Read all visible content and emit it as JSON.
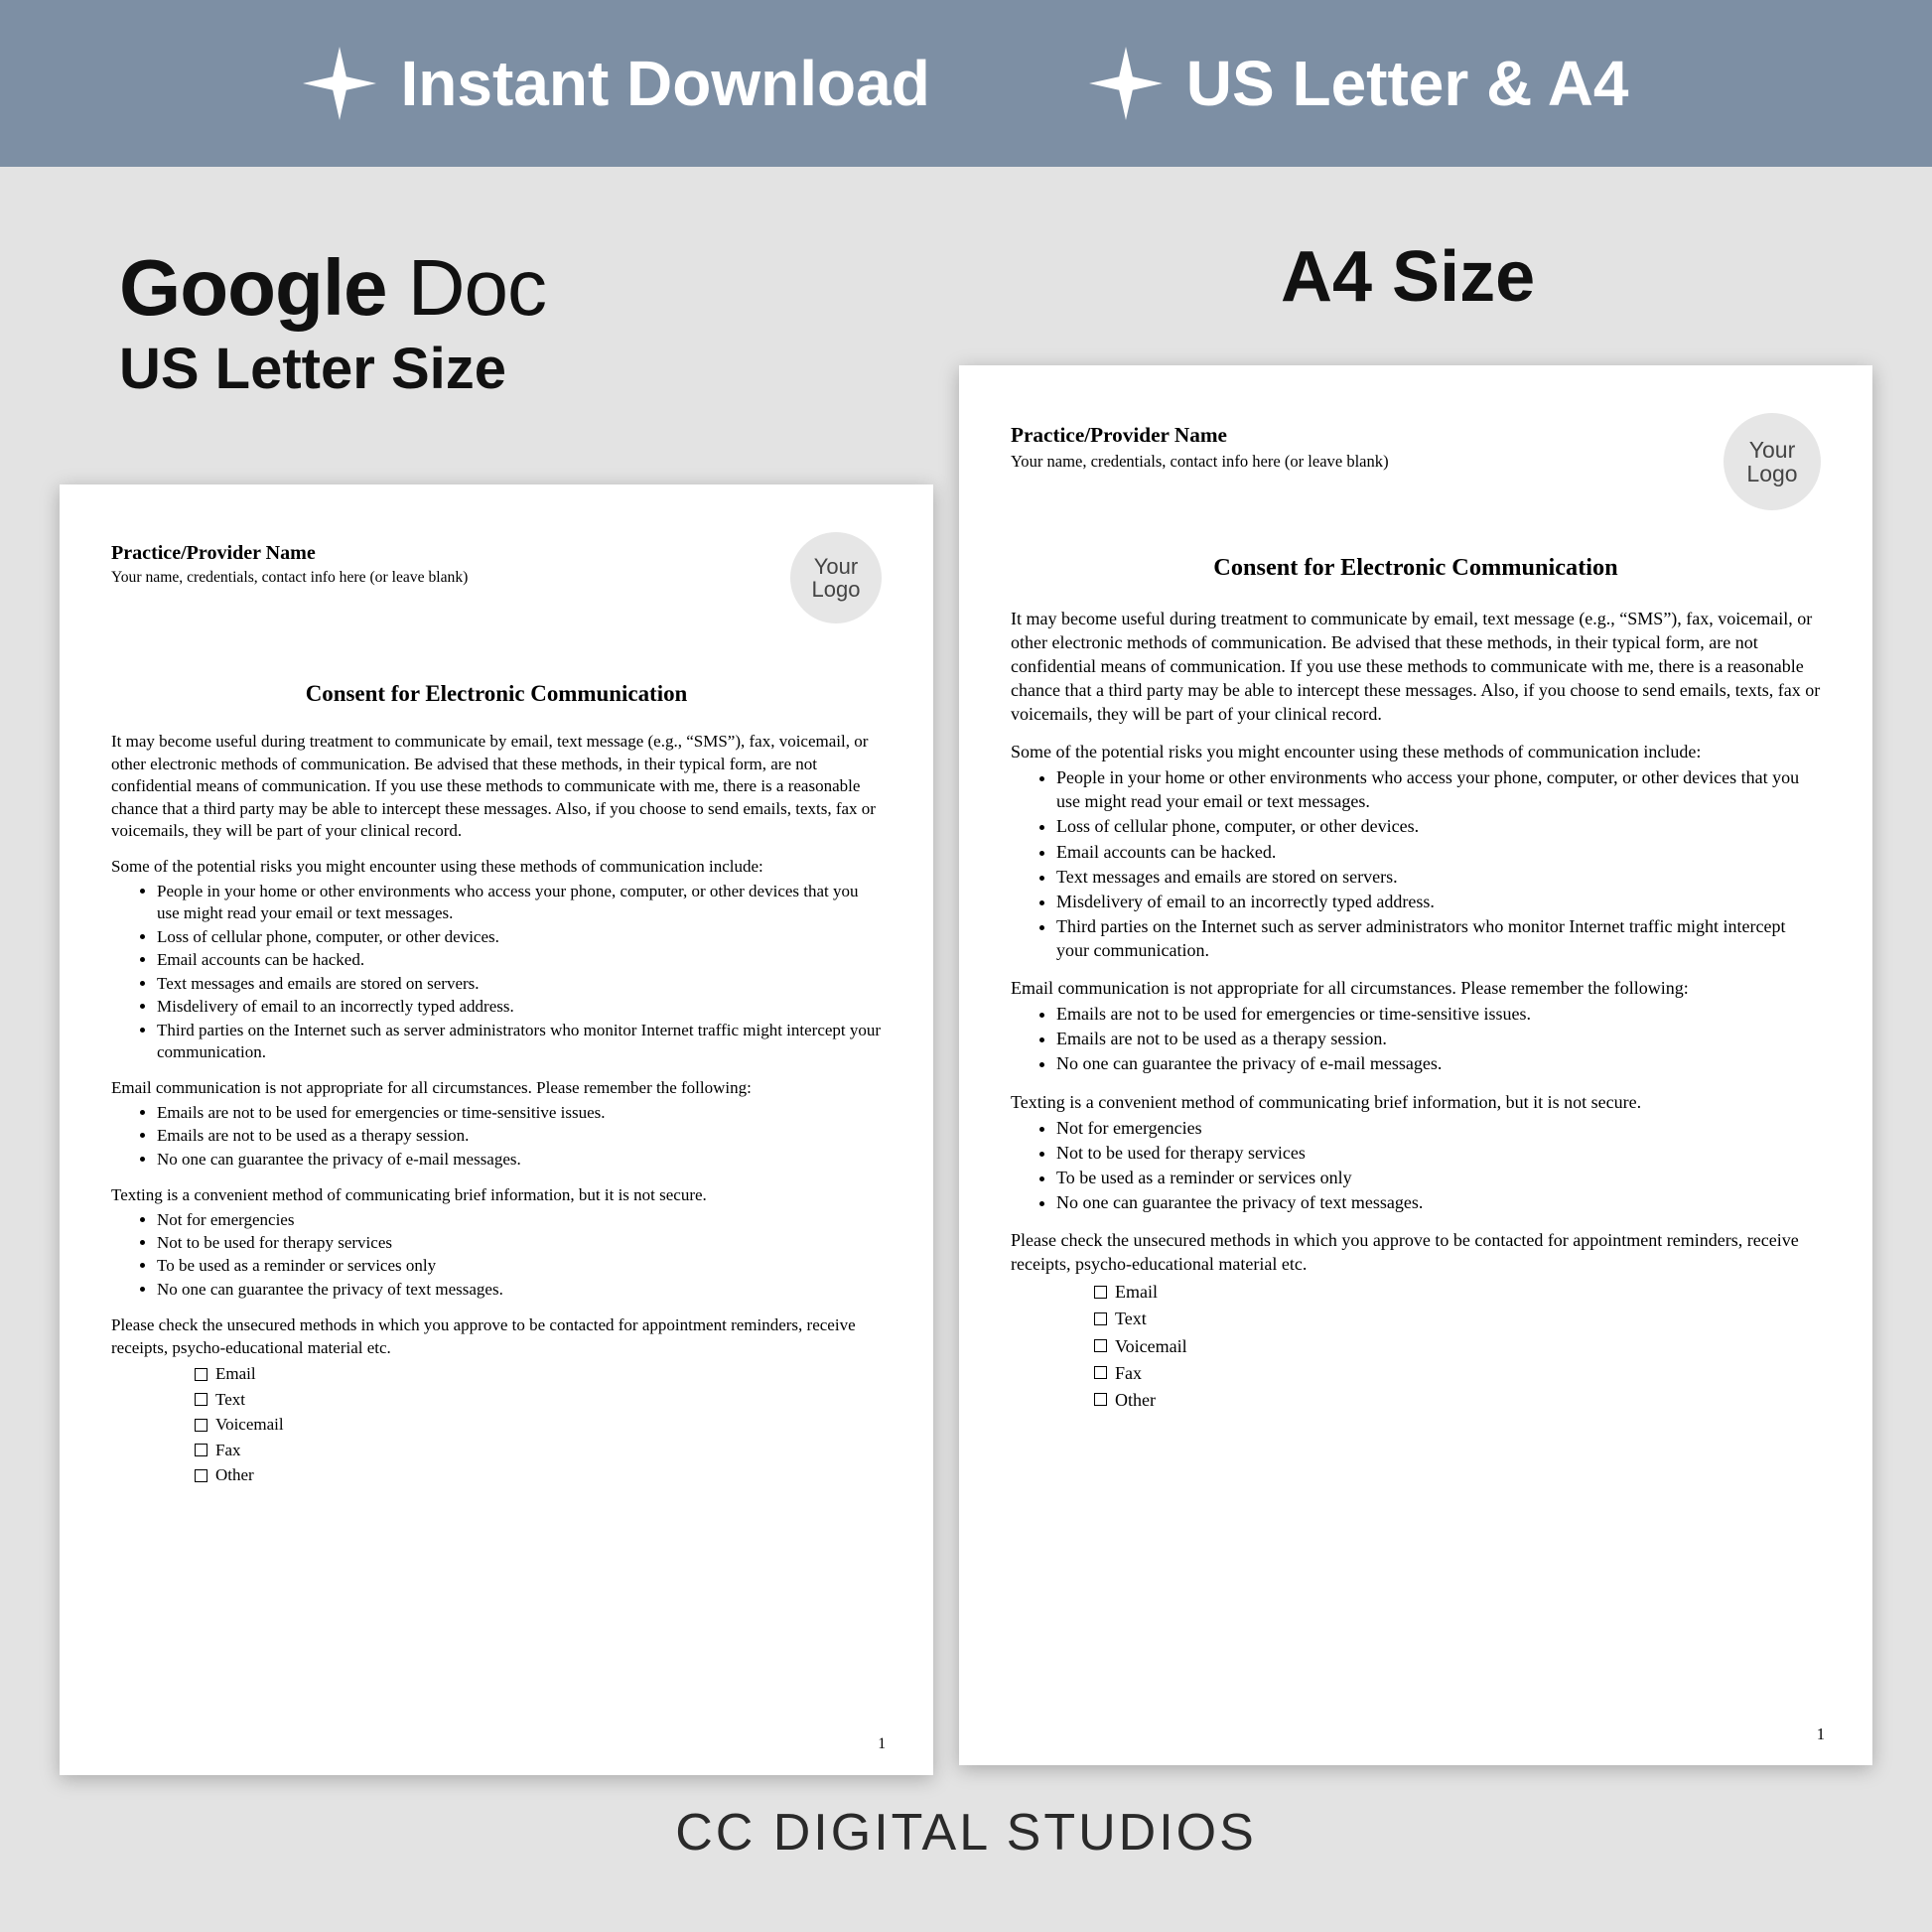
{
  "banner": {
    "item1": "Instant Download",
    "item2": "US Letter & A4"
  },
  "headings": {
    "google_bold": "Google",
    "google_light": " Doc",
    "us_letter": "US Letter Size",
    "a4": "A4 Size"
  },
  "doc": {
    "practice_name": "Practice/Provider Name",
    "practice_sub": "Your name, credentials, contact info here (or leave blank)",
    "logo_text": "Your Logo",
    "title": "Consent for Electronic Communication",
    "intro": "It may become useful during treatment to communicate by email, text message (e.g., “SMS”), fax, voicemail, or other electronic methods of communication. Be advised that these methods, in their typical form, are not confidential means of communication. If you use these methods to communicate with me, there is a reasonable chance that a third party may be able to intercept these messages.  Also, if you choose to send emails, texts, fax or voicemails, they will be part of your clinical record.",
    "risks_lead": "Some of the potential risks you might encounter using these methods of communication include:",
    "risks": [
      "People in your home or other environments who access your phone, computer, or other devices that you use might read your email or text messages.",
      "Loss of cellular phone, computer, or other devices.",
      "Email accounts can be hacked.",
      "Text messages and emails are stored on servers.",
      "Misdelivery of email to an incorrectly typed address.",
      "Third parties on the Internet such as server administrators who monitor Internet traffic might intercept your communication."
    ],
    "email_lead": "Email communication is not appropriate for all circumstances.  Please remember the following:",
    "email_notes": [
      "Emails are not to be used for emergencies or time-sensitive issues.",
      "Emails are not to be used as a therapy session.",
      "No one can guarantee the privacy of e-mail messages."
    ],
    "text_lead": "Texting is a convenient method of communicating brief information, but it is not secure.",
    "text_notes": [
      "Not for emergencies",
      "Not to be used for therapy services",
      "To be used as a reminder or services only",
      "No one can guarantee the privacy of text messages."
    ],
    "approve_lead": "Please check the unsecured methods in which you approve to be contacted for appointment reminders, receive receipts, psycho-educational material etc.",
    "checks": [
      "Email",
      "Text",
      "Voicemail",
      "Fax",
      "Other"
    ],
    "page_num": "1"
  },
  "footer": "CC DIGITAL STUDIOS"
}
